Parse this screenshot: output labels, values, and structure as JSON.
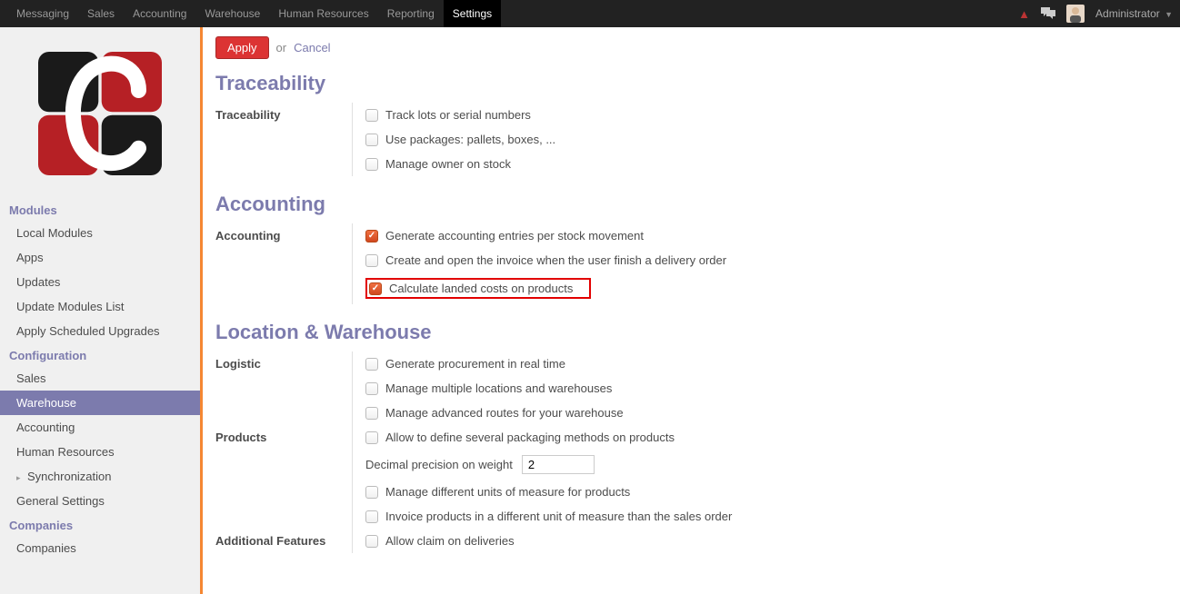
{
  "topnav": {
    "items": [
      "Messaging",
      "Sales",
      "Accounting",
      "Warehouse",
      "Human Resources",
      "Reporting",
      "Settings"
    ],
    "active_index": 6
  },
  "user": {
    "name": "Administrator"
  },
  "sidebar": {
    "sections": [
      {
        "title": "Modules",
        "items": [
          {
            "label": "Local Modules"
          },
          {
            "label": "Apps"
          },
          {
            "label": "Updates"
          },
          {
            "label": "Update Modules List"
          },
          {
            "label": "Apply Scheduled Upgrades"
          }
        ]
      },
      {
        "title": "Configuration",
        "items": [
          {
            "label": "Sales"
          },
          {
            "label": "Warehouse",
            "active": true
          },
          {
            "label": "Accounting"
          },
          {
            "label": "Human Resources"
          },
          {
            "label": "Synchronization",
            "has_caret": true
          },
          {
            "label": "General Settings"
          }
        ]
      },
      {
        "title": "Companies",
        "items": [
          {
            "label": "Companies"
          }
        ]
      }
    ]
  },
  "actions": {
    "apply": "Apply",
    "or": "or",
    "cancel": "Cancel"
  },
  "form": {
    "sections": [
      {
        "heading": "Traceability",
        "groups": [
          {
            "label": "Traceability",
            "options": [
              {
                "text": "Track lots or serial numbers",
                "checked": false
              },
              {
                "text": "Use packages: pallets, boxes, ...",
                "checked": false
              },
              {
                "text": "Manage owner on stock",
                "checked": false
              }
            ]
          }
        ]
      },
      {
        "heading": "Accounting",
        "groups": [
          {
            "label": "Accounting",
            "options": [
              {
                "text": "Generate accounting entries per stock movement",
                "checked": true
              },
              {
                "text": "Create and open the invoice when the user finish a delivery order",
                "checked": false
              },
              {
                "text": "Calculate landed costs on products",
                "checked": true,
                "highlight": true
              }
            ]
          }
        ]
      },
      {
        "heading": "Location & Warehouse",
        "groups": [
          {
            "label": "Logistic",
            "options": [
              {
                "text": "Generate procurement in real time",
                "checked": false
              },
              {
                "text": "Manage multiple locations and warehouses",
                "checked": false
              },
              {
                "text": "Manage advanced routes for your warehouse",
                "checked": false
              }
            ]
          },
          {
            "label": "Products",
            "options": [
              {
                "text": "Allow to define several packaging methods on products",
                "checked": false
              },
              {
                "type": "input",
                "label": "Decimal precision on weight",
                "value": "2"
              },
              {
                "text": "Manage different units of measure for products",
                "checked": false
              },
              {
                "text": "Invoice products in a different unit of measure than the sales order",
                "checked": false
              }
            ]
          },
          {
            "label": "Additional Features",
            "options": [
              {
                "text": "Allow claim on deliveries",
                "checked": false
              }
            ]
          }
        ]
      }
    ]
  }
}
